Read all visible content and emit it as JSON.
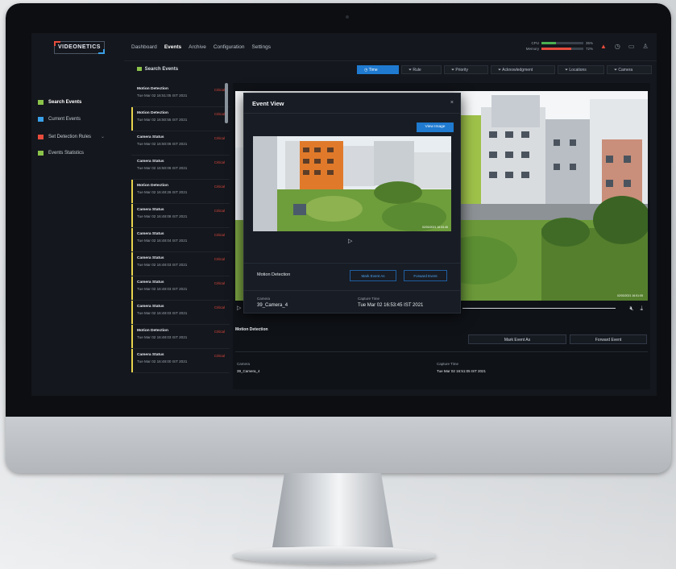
{
  "app": {
    "logo": "VIDEONETICS",
    "nav": [
      "Dashboard",
      "Events",
      "Archive",
      "Configuration",
      "Settings"
    ],
    "active_nav": "Events",
    "meters": [
      {
        "label": "CPU",
        "percent": 35,
        "display": "35%",
        "color": "#4caf50"
      },
      {
        "label": "Memory",
        "percent": 72,
        "display": "72%",
        "color": "#e74c3c"
      }
    ],
    "icons": [
      "alert-icon",
      "clock-icon",
      "chat-icon",
      "user-icon"
    ]
  },
  "sidebar": {
    "items": [
      {
        "label": "Search Events",
        "icon": "search-events-icon",
        "color": "#8bc34a",
        "active": true
      },
      {
        "label": "Current Events",
        "icon": "current-events-icon",
        "color": "#3aa0e8",
        "active": false
      },
      {
        "label": "Set Detection Rules",
        "icon": "rules-icon",
        "color": "#e74c3c",
        "active": false
      },
      {
        "label": "Events Statistics",
        "icon": "statistics-icon",
        "color": "#8bc34a",
        "active": false
      }
    ]
  },
  "filterbar": {
    "title": "Search Events",
    "filters": [
      "Time",
      "Rule",
      "Priority",
      "Acknowledgment",
      "Locations",
      "Camera"
    ],
    "active_filter": "Time"
  },
  "events": [
    {
      "type": "Motion Detection",
      "time": "Tue Mar 02 16:51:05 IST 2021",
      "severity": "Critical",
      "marked": false
    },
    {
      "type": "Motion Detection",
      "time": "Tue Mar 02 16:50:55 IST 2021",
      "severity": "Critical",
      "marked": true
    },
    {
      "type": "Camera Status",
      "time": "Tue Mar 02 16:50:06 IST 2021",
      "severity": "Critical",
      "marked": false
    },
    {
      "type": "Camera Status",
      "time": "Tue Mar 02 16:50:06 IST 2021",
      "severity": "Critical",
      "marked": false
    },
    {
      "type": "Motion Detection",
      "time": "Tue Mar 02 16:48:26 IST 2021",
      "severity": "Critical",
      "marked": true
    },
    {
      "type": "Camera Status",
      "time": "Tue Mar 02 16:48:08 IST 2021",
      "severity": "Critical",
      "marked": true
    },
    {
      "type": "Camera Status",
      "time": "Tue Mar 02 16:48:04 IST 2021",
      "severity": "Critical",
      "marked": true
    },
    {
      "type": "Camera Status",
      "time": "Tue Mar 02 16:48:03 IST 2021",
      "severity": "Critical",
      "marked": true
    },
    {
      "type": "Camera Status",
      "time": "Tue Mar 02 16:48:03 IST 2021",
      "severity": "Critical",
      "marked": true
    },
    {
      "type": "Camera Status",
      "time": "Tue Mar 02 16:48:03 IST 2021",
      "severity": "Critical",
      "marked": true
    },
    {
      "type": "Motion Detection",
      "time": "Tue Mar 02 16:48:03 IST 2021",
      "severity": "Critical",
      "marked": true
    },
    {
      "type": "Camera Status",
      "time": "Tue Mar 02 16:48:00 IST 2021",
      "severity": "Critical",
      "marked": true
    }
  ],
  "detail": {
    "title": "Motion Detection",
    "mark_event_label": "Mark Event As",
    "forward_event_label": "Forward Event",
    "camera_label": "Camera",
    "camera_value": "39_Camera_4",
    "capture_label": "Capture Time",
    "capture_value": "Tue Mar 02 16:51:05 IST 2021",
    "video_timestamp": "02/03/2021 16:51:05"
  },
  "modal": {
    "title": "Event View",
    "close": "×",
    "view_image_label": "View Image",
    "video_timestamp": "02/03/2021 16:53:45",
    "detection": "Motion Detection",
    "mark_event_label": "Mark Event As",
    "forward_event_label": "Forward Event",
    "camera_label": "Camera",
    "camera_value": "39_Camera_4",
    "capture_label": "Capture Time",
    "capture_value": "Tue Mar 02 16:53:45 IST 2021"
  }
}
